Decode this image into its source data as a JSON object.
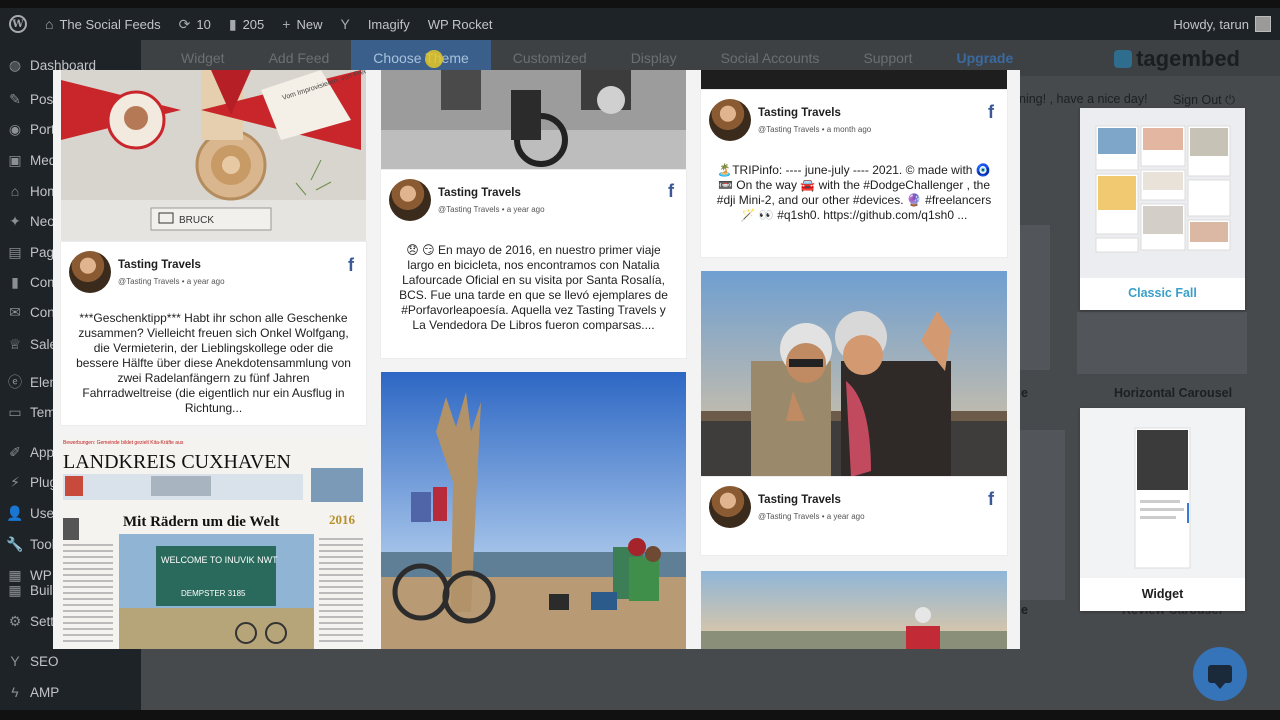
{
  "admin_bar": {
    "site_name": "The Social Feeds",
    "updates_count": "10",
    "comments_count": "205",
    "new_label": "New",
    "imagify_label": "Imagify",
    "wp_rocket_label": "WP Rocket",
    "howdy": "Howdy, tarun"
  },
  "sidebar": {
    "items": [
      {
        "label": "Dashboard",
        "icon": "dashboard-icon"
      },
      {
        "label": "Posts",
        "icon": "pin-icon"
      },
      {
        "label": "Portfolio",
        "icon": "portfolio-icon"
      },
      {
        "label": "Media",
        "icon": "media-icon"
      },
      {
        "label": "Home",
        "icon": "home-icon"
      },
      {
        "label": "Neo",
        "icon": "neo-icon"
      },
      {
        "label": "Pages",
        "icon": "pages-icon"
      },
      {
        "label": "Comments",
        "icon": "comments-icon"
      },
      {
        "label": "Contact",
        "icon": "mail-icon"
      },
      {
        "label": "Sales",
        "icon": "chart-icon"
      },
      {
        "label": "Elementor",
        "icon": "elementor-icon"
      },
      {
        "label": "Templates",
        "icon": "templates-icon"
      },
      {
        "label": "Appearance",
        "icon": "brush-icon"
      },
      {
        "label": "Plugins",
        "icon": "plug-icon"
      },
      {
        "label": "Users",
        "icon": "users-icon"
      },
      {
        "label": "Tools",
        "icon": "wrench-icon"
      },
      {
        "label": "WP",
        "icon": "builder-icon"
      },
      {
        "label": "Build",
        "icon": "builder-icon"
      },
      {
        "label": "Settings",
        "icon": "settings-icon"
      },
      {
        "label": "SEO",
        "icon": "seo-icon"
      },
      {
        "label": "AMP",
        "icon": "amp-icon"
      }
    ]
  },
  "plugin_nav": {
    "tabs": [
      "Widget",
      "Add Feed",
      "Choose Theme",
      "Customized",
      "Display",
      "Social Accounts",
      "Support",
      "Upgrade"
    ],
    "brand": "tagembed",
    "greeting": "ning! , have a nice day!",
    "sign_out": "Sign Out"
  },
  "themes": {
    "classic_fall": "Classic Fall",
    "horizontal_carousel": "Horizontal Carousel",
    "widget": "Widget",
    "review_carousel": "Review Carousel"
  },
  "modal": {
    "posts": [
      {
        "author": "Tasting Travels",
        "handle": "@Tasting Travels",
        "time": "a year ago",
        "text": "***Geschenktipp*** Habt ihr schon alle Geschenke zusammen? Vielleicht freuen sich Onkel Wolfgang, die Vermieterin, der Lieblingskollege oder die bessere Hälfte über diese Anekdotensammlung von zwei Radelanfängern zu fünf Jahren Fahrradweltreise (die eigentlich nur ein Ausflug in Richtung..."
      },
      {
        "author": "Tasting Travels",
        "handle": "@Tasting Travels",
        "time": "a year ago",
        "text": "😞 😏 En mayo de 2016, en nuestro primer viaje largo en bicicleta, nos encontramos con Natalia Lafourcade Oficial en su visita por Santa Rosalía, BCS. Fue una tarde en que se llevó ejemplares de #Porfavorleapoesía. Aquella vez Tasting Travels y La Vendedora De Libros fueron comparsas...."
      },
      {
        "author": "Tasting Travels",
        "handle": "@Tasting Travels",
        "time": "a month ago",
        "text": "🏝️TRIPinfo: ---- june-july ---- 2021. © made with 🧿 📼 On the way 🚘 with the #DodgeChallenger , the #dji Mini-2, and our other #devices. 🔮 #freelancers 🪄 👀 #q1sh0. https://github.com/q1sh0 ..."
      },
      {
        "author": "Tasting Travels",
        "handle": "@Tasting Travels",
        "time": "a year ago",
        "text": ""
      }
    ],
    "newspaper": {
      "masthead": "LANDKREIS CUXHAVEN",
      "headline": "Mit Rädern um die Welt",
      "year": "2016",
      "sign": "WELCOME TO INUVIK NWT",
      "sign2": "DEMPSTER 3185",
      "top_line": "Bewerbungen: Gemeinde bildet gezielt Kita-Kräfte aus"
    },
    "gift": {
      "tag_text": "Vom Improvisieren, von Freundschaften & kleinen & großen Abenteuern",
      "book_text": "BRUCK"
    }
  }
}
